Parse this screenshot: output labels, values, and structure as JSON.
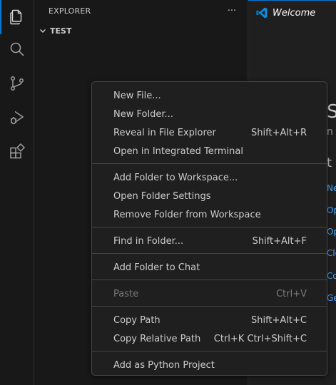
{
  "activity_bar": {
    "items": [
      {
        "icon": "files-icon",
        "active": true
      },
      {
        "icon": "search-icon",
        "active": false
      },
      {
        "icon": "source-control-icon",
        "active": false
      },
      {
        "icon": "run-debug-icon",
        "active": false
      },
      {
        "icon": "extensions-icon",
        "active": false
      }
    ]
  },
  "sidebar": {
    "title": "EXPLORER",
    "more_label": "···",
    "folder": "TEST"
  },
  "editor": {
    "tab_label": "Welcome",
    "heading_fragment": "S",
    "sub_fragment": "n",
    "section_fragment": "t",
    "links": [
      "Ne",
      "Op",
      "Op",
      "Clo",
      "Co",
      "Ge"
    ]
  },
  "context_menu": {
    "groups": [
      [
        {
          "label": "New File...",
          "shortcut": ""
        },
        {
          "label": "New Folder...",
          "shortcut": ""
        },
        {
          "label": "Reveal in File Explorer",
          "shortcut": "Shift+Alt+R"
        },
        {
          "label": "Open in Integrated Terminal",
          "shortcut": ""
        }
      ],
      [
        {
          "label": "Add Folder to Workspace...",
          "shortcut": ""
        },
        {
          "label": "Open Folder Settings",
          "shortcut": ""
        },
        {
          "label": "Remove Folder from Workspace",
          "shortcut": ""
        }
      ],
      [
        {
          "label": "Find in Folder...",
          "shortcut": "Shift+Alt+F"
        }
      ],
      [
        {
          "label": "Add Folder to Chat",
          "shortcut": ""
        }
      ],
      [
        {
          "label": "Paste",
          "shortcut": "Ctrl+V",
          "disabled": true
        }
      ],
      [
        {
          "label": "Copy Path",
          "shortcut": "Shift+Alt+C"
        },
        {
          "label": "Copy Relative Path",
          "shortcut": "Ctrl+K Ctrl+Shift+C"
        }
      ],
      [
        {
          "label": "Add as Python Project",
          "shortcut": ""
        }
      ]
    ]
  },
  "colors": {
    "accent": "#0078d4",
    "link": "#4daafc",
    "menu_bg": "#1f1f1f",
    "sidebar_bg": "#181818"
  }
}
